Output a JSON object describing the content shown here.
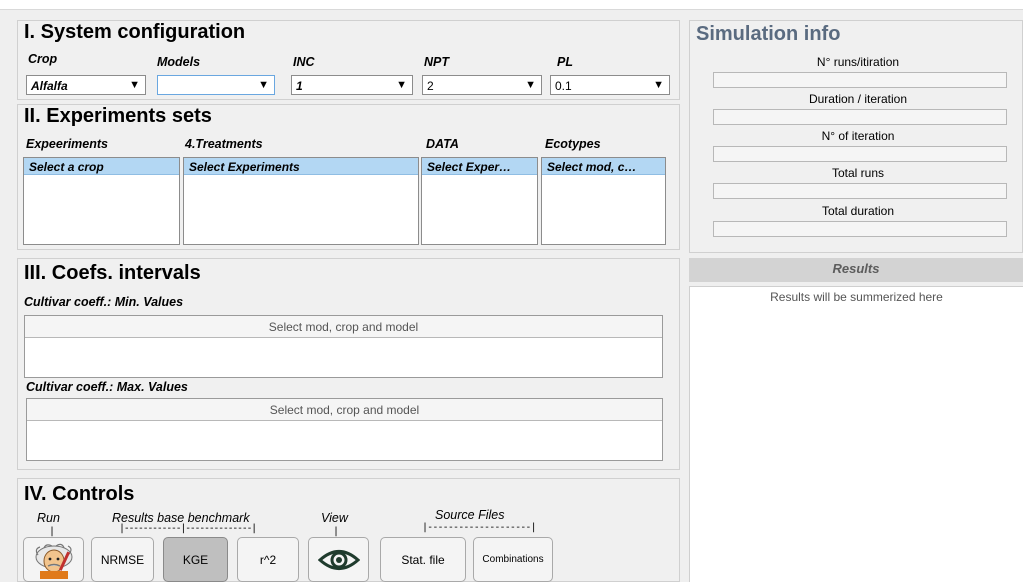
{
  "system_config": {
    "title": "I. System configuration",
    "labels": {
      "crop": "Crop",
      "models": "Models",
      "inc": "INC",
      "npt": "NPT",
      "pl": "PL"
    },
    "crop_value": "Alfalfa",
    "models_value": "",
    "inc_value": "1",
    "npt_value": "2",
    "pl_value": "0.1",
    "dropdown_arrow": "▼"
  },
  "experiments": {
    "title": "II. Experiments sets",
    "labels": {
      "experiments": "Expeeriments",
      "treatments": "4.Treatments",
      "data": "DATA",
      "ecotypes": "Ecotypes"
    },
    "experiments_item": "Select a crop",
    "treatments_item": "Select Experiments",
    "data_item": "Select Exper…",
    "ecotypes_item": "Select mod, c…"
  },
  "coefs": {
    "title": "III. Coefs. intervals",
    "min_label": "Cultivar coeff.: Min. Values",
    "min_header": "Select mod, crop and model",
    "max_label": "Cultivar coeff.: Max. Values",
    "max_header": "Select mod, crop and model"
  },
  "controls": {
    "title": "IV. Controls",
    "run_label": "Run",
    "benchmark_label": "Results base benchmark",
    "view_label": "View",
    "source_label": "Source Files",
    "benchmark_dashes": "|------------|--------------|",
    "source_dashes": "|--------------------|",
    "tick": "|",
    "nrmse": "NRMSE",
    "kge": "KGE",
    "r2": "r^2",
    "stat_file": "Stat. file",
    "combinations": "Combinations",
    "run_icon": "einstein-avatar-icon",
    "view_icon": "eye-icon",
    "selected_benchmark": "KGE"
  },
  "sim_info": {
    "title": "Simulation info",
    "runs_per_iteration": "N° runs/itiration",
    "duration_per_iteration": "Duration / iteration",
    "n_iterations": "N° of iteration",
    "total_runs": "Total runs",
    "total_duration": "Total duration"
  },
  "results": {
    "header": "Results",
    "placeholder": "Results will be summerized here"
  },
  "colors": {
    "selection": "#b3d7f3",
    "sim_title": "#5a6b80",
    "panel_bg": "#f0f0f0"
  }
}
